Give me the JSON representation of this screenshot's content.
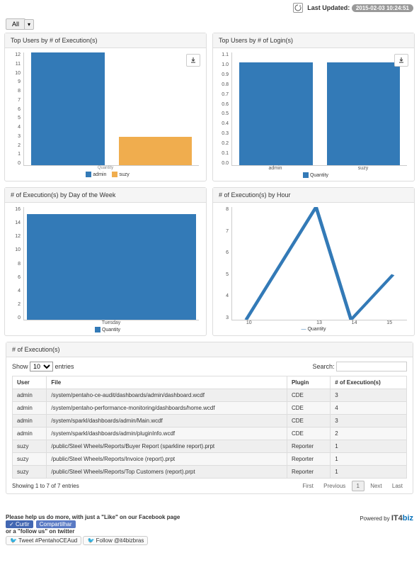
{
  "header": {
    "last_updated_label": "Last Updated:",
    "timestamp": "2015-02-03 10:24:51"
  },
  "filter": {
    "all_label": "All"
  },
  "panels": {
    "top_exec": "Top Users by # of Execution(s)",
    "top_login": "Top Users by # of Login(s)",
    "by_dow": "# of Execution(s) by Day of the Week",
    "by_hour": "# of Execution(s) by Hour"
  },
  "legend": {
    "admin": "admin",
    "suzy": "suzy",
    "quantity": "Quantity",
    "quantity_line": "Quantity"
  },
  "axis_title_quantity": "Quantity",
  "dow_category": "Tuesday",
  "table": {
    "title": "# of Execution(s)",
    "show_label": "Show",
    "entries_label": "entries",
    "page_size": "10",
    "search_label": "Search:",
    "cols": {
      "user": "User",
      "file": "File",
      "plugin": "Plugin",
      "execs": "# of Execution(s)"
    },
    "rows": [
      {
        "user": "admin",
        "file": "/system/pentaho-ce-audit/dashboards/admin/dashboard.wcdf",
        "plugin": "CDE",
        "n": "3"
      },
      {
        "user": "admin",
        "file": "/system/pentaho-performance-monitoring/dashboards/home.wcdf",
        "plugin": "CDE",
        "n": "4"
      },
      {
        "user": "admin",
        "file": "/system/sparkl/dashboards/admin/Main.wcdf",
        "plugin": "CDE",
        "n": "3"
      },
      {
        "user": "admin",
        "file": "/system/sparkl/dashboards/admin/pluginInfo.wcdf",
        "plugin": "CDE",
        "n": "2"
      },
      {
        "user": "suzy",
        "file": "/public/Steel Wheels/Reports/Buyer Report (sparkline report).prpt",
        "plugin": "Reporter",
        "n": "1"
      },
      {
        "user": "suzy",
        "file": "/public/Steel Wheels/Reports/Invoice (report).prpt",
        "plugin": "Reporter",
        "n": "1"
      },
      {
        "user": "suzy",
        "file": "/public/Steel Wheels/Reports/Top Customers (report).prpt",
        "plugin": "Reporter",
        "n": "1"
      }
    ],
    "info": "Showing 1 to 7 of 7 entries",
    "pager": {
      "first": "First",
      "prev": "Previous",
      "p1": "1",
      "next": "Next",
      "last": "Last"
    }
  },
  "footer": {
    "like_line": "Please help us do more, with just a \"Like\" on our Facebook page",
    "curtir": "Curtir",
    "compartilhar": "Compartilhar",
    "follow_line": "or a \"follow us\" on twitter",
    "tweet_btn": "Tweet #PentahoCEAud",
    "follow_btn": "Follow @it4bizbras",
    "powered": "Powered by",
    "logo_a": "IT4",
    "logo_b": "biz"
  },
  "chart_data": [
    {
      "type": "bar",
      "title": "Top Users by # of Execution(s)",
      "categories": [
        "admin",
        "suzy"
      ],
      "values": [
        12,
        3
      ],
      "series_colors": [
        "#337ab7",
        "#f0ad4e"
      ],
      "ylim": [
        0,
        12
      ],
      "ylabel": "",
      "xlabel": "Quantity",
      "legend": [
        "admin",
        "suzy"
      ]
    },
    {
      "type": "bar",
      "title": "Top Users by # of Login(s)",
      "categories": [
        "admin",
        "suzy"
      ],
      "values": [
        1.0,
        1.0
      ],
      "ylim": [
        0.0,
        1.1
      ],
      "ylabel": "",
      "xlabel": "",
      "legend": [
        "Quantity"
      ]
    },
    {
      "type": "bar",
      "title": "# of Execution(s) by Day of the Week",
      "categories": [
        "Tuesday"
      ],
      "values": [
        15
      ],
      "ylim": [
        0,
        16
      ],
      "legend": [
        "Quantity"
      ]
    },
    {
      "type": "line",
      "title": "# of Execution(s) by Hour",
      "x": [
        10,
        13,
        14,
        15
      ],
      "series": [
        {
          "name": "Quantity",
          "values": [
            3,
            8,
            3,
            5
          ]
        }
      ],
      "ylim": [
        3,
        8
      ],
      "xlabel": "",
      "ylabel": ""
    }
  ]
}
